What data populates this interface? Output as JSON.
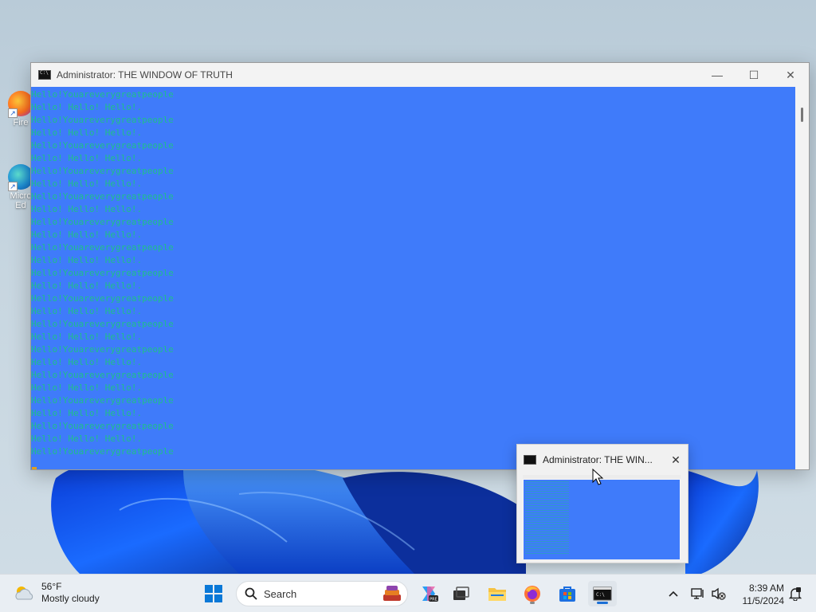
{
  "desktop": {
    "icons": [
      {
        "label": "Fire"
      },
      {
        "label": "Micro Ed"
      }
    ]
  },
  "window": {
    "title": "Administrator:  THE WINDOW OF TRUTH",
    "minimize_glyph": "—",
    "maximize_glyph": "☐",
    "close_glyph": "✕",
    "console_bg": "#3f7bfa",
    "console_fg": "#1fbf8a",
    "lines": [
      "Hello!Youareverygreatpeople",
      "Hello! Hello! Hello!.",
      "Hello!Youareverygreatpeople",
      "Hello! Hello! Hello!.",
      "Hello!Youareverygreatpeople",
      "Hello! Hello! Hello!.",
      "Hello!Youareverygreatpeople",
      "Hello! Hello! Hello!.",
      "Hello!Youareverygreatpeople",
      "Hello! Hello! Hello!.",
      "Hello!Youareverygreatpeople",
      "Hello! Hello! Hello!.",
      "Hello!Youareverygreatpeople",
      "Hello! Hello! Hello!.",
      "Hello!Youareverygreatpeople",
      "Hello! Hello! Hello!.",
      "Hello!Youareverygreatpeople",
      "Hello! Hello! Hello!.",
      "Hello!Youareverygreatpeople",
      "Hello! Hello! Hello!.",
      "Hello!Youareverygreatpeople",
      "Hello! Hello! Hello!.",
      "Hello!Youareverygreatpeople",
      "Hello! Hello! Hello!.",
      "Hello!Youareverygreatpeople",
      "Hello! Hello! Hello!.",
      "Hello!Youareverygreatpeople",
      "Hello! Hello! Hello!.",
      "Hello!Youareverygreatpeople"
    ]
  },
  "preview": {
    "title": "Administrator:  THE WIN...",
    "close_glyph": "✕"
  },
  "taskbar": {
    "weather": {
      "temp": "56°F",
      "condition": "Mostly cloudy"
    },
    "search_label": "Search",
    "clock": {
      "time": "8:39 AM",
      "date": "11/5/2024"
    },
    "apps": [
      "start-icon",
      "copilot-icon",
      "task-view-icon",
      "file-explorer-icon",
      "firefox-icon",
      "store-icon",
      "terminal-icon"
    ]
  }
}
